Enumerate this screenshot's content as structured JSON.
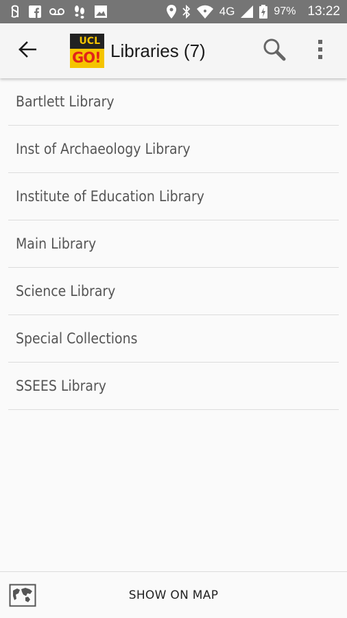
{
  "status_bar": {
    "network": "4G",
    "battery": "97%",
    "time": "13:22",
    "icons": [
      "s-app-icon",
      "facebook-icon",
      "voicemail-icon",
      "footsteps-icon",
      "image-icon",
      "location-icon",
      "bluetooth-icon",
      "wifi-icon",
      "signal-icon",
      "battery-charging-icon"
    ]
  },
  "app_bar": {
    "title": "Libraries (7)",
    "logo": {
      "top_text": "UCL",
      "bottom_text": "GO!"
    },
    "back_icon": "arrow-left-icon",
    "search_icon": "search-icon",
    "more_icon": "more-vert-icon"
  },
  "libraries": [
    {
      "label": "Bartlett Library"
    },
    {
      "label": "Inst of Archaeology Library"
    },
    {
      "label": "Institute of Education Library"
    },
    {
      "label": "Main Library"
    },
    {
      "label": "Science Library"
    },
    {
      "label": "Special Collections"
    },
    {
      "label": "SSEES Library"
    }
  ],
  "bottom_bar": {
    "map_icon": "world-map-icon",
    "show_on_map_label": "SHOW ON MAP"
  },
  "colors": {
    "status_bar": "#757575",
    "app_bar": "#f5f5f5",
    "logo_yellow": "#f5c400",
    "logo_red": "#e2231a",
    "list_text": "#555555",
    "divider": "#dcdcdc"
  }
}
